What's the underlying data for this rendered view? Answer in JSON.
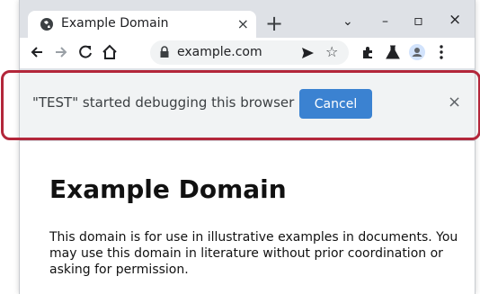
{
  "tab": {
    "title": "Example Domain",
    "close_glyph": "×"
  },
  "tabstrip": {
    "new_tab_glyph": "+",
    "dropdown_glyph": "⌄",
    "minimize_glyph": "–",
    "maximize_glyph": "▫",
    "close_glyph": "×"
  },
  "toolbar": {
    "url": "example.com",
    "icons": [
      "back-icon",
      "forward-icon",
      "reload-icon",
      "home-icon",
      "lock-icon",
      "send-icon",
      "star-icon",
      "extensions-icon",
      "labs-icon",
      "profile-icon",
      "menu-icon"
    ]
  },
  "infobar": {
    "message": "\"TEST\" started debugging this browser",
    "cancel_label": "Cancel",
    "dismiss_glyph": "×"
  },
  "page": {
    "heading": "Example Domain",
    "paragraph": "This domain is for use in illustrative examples in documents. You may use this domain in literature without prior coordination or asking for permission."
  },
  "colors": {
    "highlight": "#b3263a",
    "accent": "#3b82d1",
    "chrome": "#dee1e6"
  }
}
